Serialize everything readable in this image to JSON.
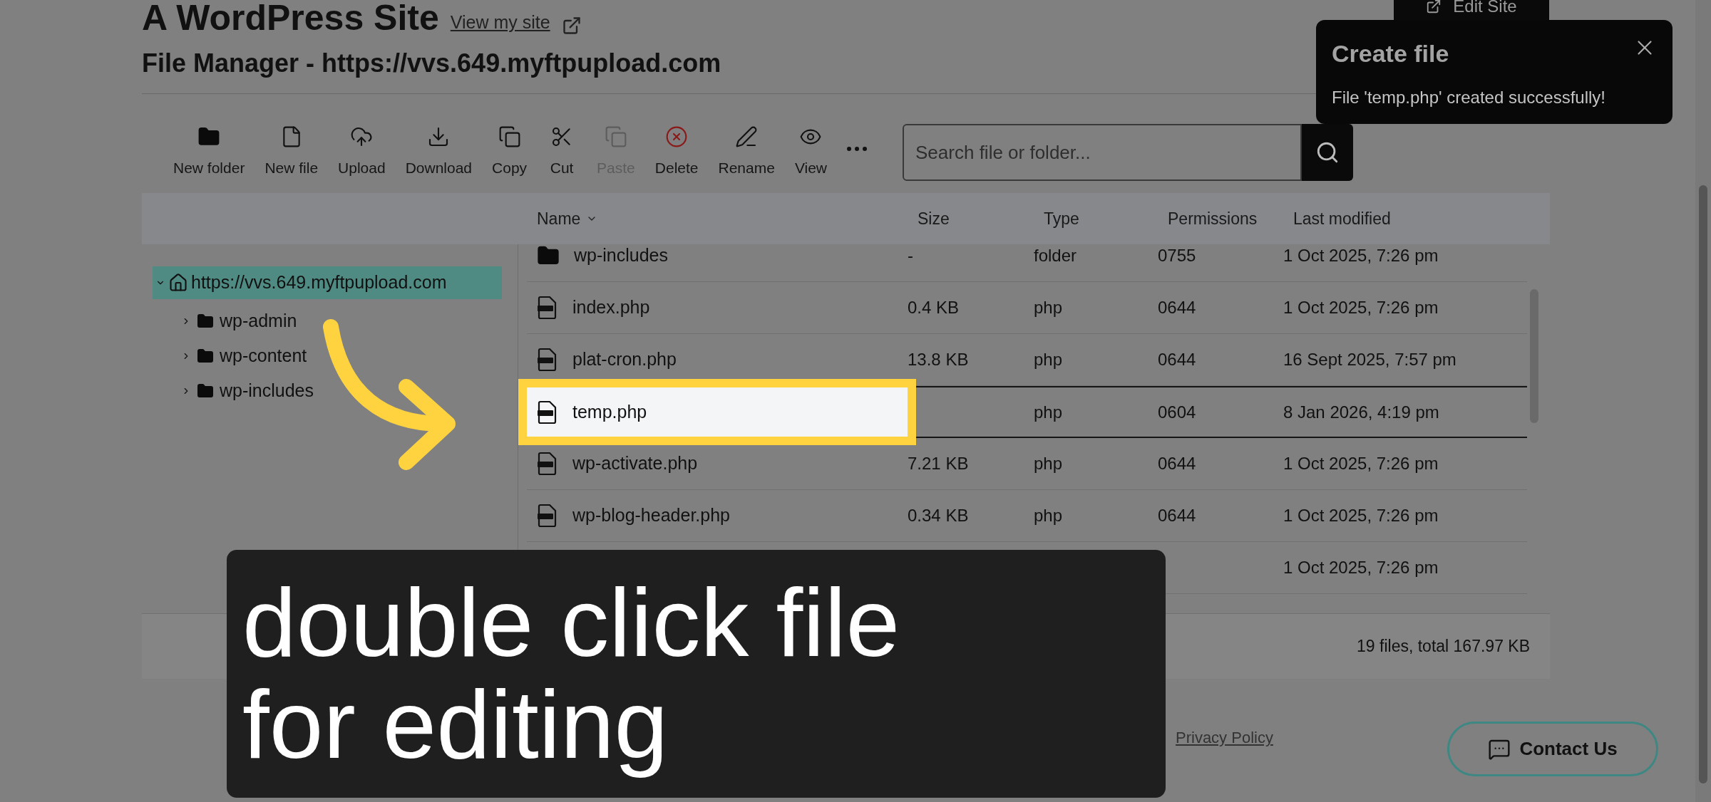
{
  "page": {
    "title": "A WordPress Site",
    "view_link": "View my site",
    "edit_button": "Edit Site"
  },
  "file_manager": {
    "title": "File Manager - https://vvs.649.myftpupload.com",
    "toolbar": [
      {
        "kind": "new-folder",
        "label": "New folder",
        "disabled": false
      },
      {
        "kind": "new-file",
        "label": "New file",
        "disabled": false
      },
      {
        "kind": "upload",
        "label": "Upload",
        "disabled": false
      },
      {
        "kind": "download",
        "label": "Download",
        "disabled": false
      },
      {
        "kind": "copy",
        "label": "Copy",
        "disabled": false
      },
      {
        "kind": "cut",
        "label": "Cut",
        "disabled": false
      },
      {
        "kind": "paste",
        "label": "Paste",
        "disabled": true
      },
      {
        "kind": "delete",
        "label": "Delete",
        "disabled": false
      },
      {
        "kind": "rename",
        "label": "Rename",
        "disabled": false
      },
      {
        "kind": "view",
        "label": "View",
        "disabled": false
      },
      {
        "kind": "more"
      }
    ],
    "search": {
      "placeholder": "Search file or folder..."
    },
    "columns": [
      "Name",
      "Size",
      "Type",
      "Permissions",
      "Last modified"
    ],
    "tree": {
      "label": "https://vvs.649.myftpupload.com",
      "selected": true,
      "expanded": true,
      "children": [
        {
          "label": "wp-admin",
          "expanded": false
        },
        {
          "label": "wp-content",
          "expanded": false
        },
        {
          "label": "wp-includes",
          "expanded": false
        }
      ]
    },
    "rows": [
      {
        "kind": "folder",
        "name": "wp-includes",
        "size": "-",
        "type": "folder",
        "permissions": "0755",
        "modified": "1 Oct 2025, 7:26 pm",
        "selected": false,
        "highlighted": false
      },
      {
        "kind": "php",
        "name": "index.php",
        "size": "0.4 KB",
        "type": "php",
        "permissions": "0644",
        "modified": "1 Oct 2025, 7:26 pm",
        "selected": false,
        "highlighted": false
      },
      {
        "kind": "php",
        "name": "plat-cron.php",
        "size": "13.8 KB",
        "type": "php",
        "permissions": "0644",
        "modified": "16 Sept 2025, 7:57 pm",
        "selected": false,
        "highlighted": false
      },
      {
        "kind": "php",
        "name": "temp.php",
        "type": "php",
        "permissions": "0604",
        "modified": "8 Jan 2026, 4:19 pm",
        "selected": true,
        "highlighted": true
      },
      {
        "kind": "php",
        "name": "wp-activate.php",
        "size": "7.21 KB",
        "type": "php",
        "permissions": "0644",
        "modified": "1 Oct 2025, 7:26 pm",
        "selected": false,
        "highlighted": false
      },
      {
        "kind": "php",
        "name": "wp-blog-header.php",
        "size": "0.34 KB",
        "type": "php",
        "permissions": "0644",
        "modified": "1 Oct 2025, 7:26 pm",
        "selected": false,
        "highlighted": false
      },
      {
        "modified": "1 Oct 2025, 7:26 pm",
        "selected": false,
        "highlighted": false
      }
    ],
    "status_bar": {
      "right": "19 files, total 167.97 KB"
    }
  },
  "toast": {
    "title": "Create file",
    "message": "File 'temp.php' created successfully!"
  },
  "footer": {
    "privacy_link": "Privacy Policy"
  },
  "contact_button": "Contact Us",
  "caption": "double click file for editing"
}
